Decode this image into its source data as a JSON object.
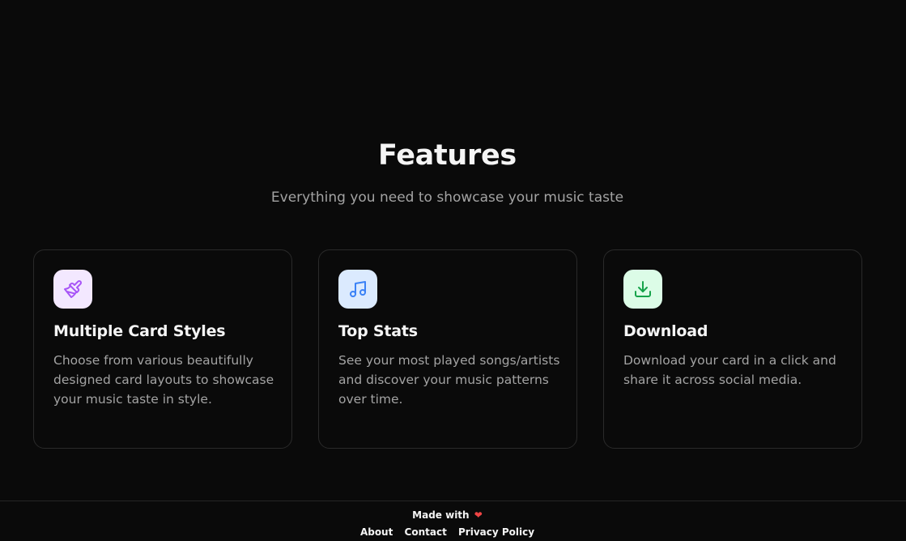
{
  "features": {
    "title": "Features",
    "subtitle": "Everything you need to showcase your music taste"
  },
  "cards": [
    {
      "icon": "paintbrush-icon",
      "title": "Multiple Card Styles",
      "description": "Choose from various beautifully designed card layouts to showcase your music taste in style."
    },
    {
      "icon": "music-note-icon",
      "title": "Top Stats",
      "description": "See your most played songs/artists and discover your music patterns over time."
    },
    {
      "icon": "download-icon",
      "title": "Download",
      "description": "Download your card in a click and share it across social media."
    }
  ],
  "footer": {
    "made_with": "Made with",
    "heart": "❤",
    "links": [
      "About",
      "Contact",
      "Privacy Policy"
    ]
  },
  "colors": {
    "background": "#0a0a0a",
    "card_border": "#2a2a2a",
    "purple_accent": "#a855f7",
    "blue_accent": "#3b82f6",
    "green_accent": "#16a34a",
    "heart": "#ef4444"
  }
}
